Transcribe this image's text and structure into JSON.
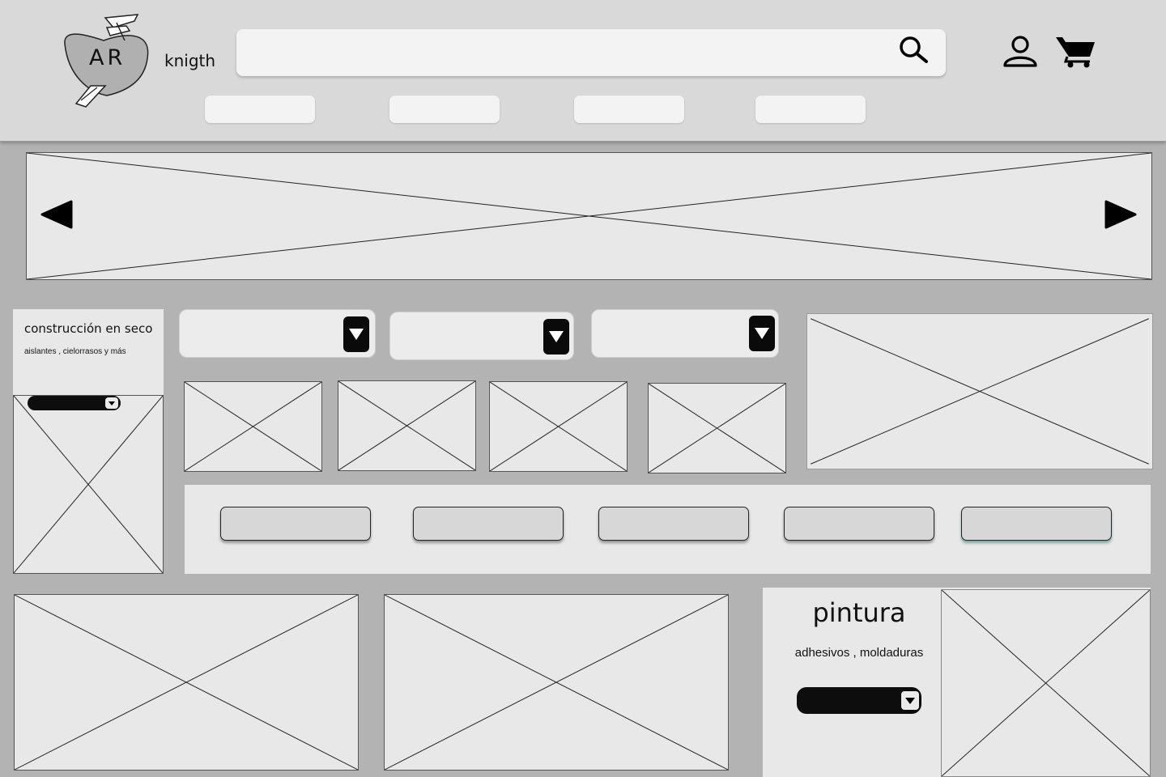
{
  "header": {
    "logo_text": "AR",
    "brand_name": "knigth",
    "search": {
      "placeholder": "",
      "value": ""
    },
    "icons": {
      "search": "search-icon",
      "user": "user-icon",
      "cart": "cart-icon"
    },
    "nav": [
      {
        "label": ""
      },
      {
        "label": ""
      },
      {
        "label": ""
      },
      {
        "label": ""
      }
    ]
  },
  "carousel": {
    "prev_icon": "arrow-left-icon",
    "next_icon": "arrow-right-icon"
  },
  "category_card": {
    "title": "construcción en seco",
    "subtitle": "aislantes , cielorrasos y más"
  },
  "filters": [
    {
      "selected": ""
    },
    {
      "selected": ""
    },
    {
      "selected": ""
    }
  ],
  "button_strip": [
    {
      "label": ""
    },
    {
      "label": ""
    },
    {
      "label": ""
    },
    {
      "label": ""
    },
    {
      "label": ""
    }
  ],
  "paint_card": {
    "title": "pintura",
    "subtitle": "adhesivos , moldaduras"
  },
  "colors": {
    "page_bg": "#b3b3b3",
    "header_bg": "#d9d9d9",
    "placeholder_bg": "#e8e8e8",
    "dark": "#0d0d0d"
  }
}
